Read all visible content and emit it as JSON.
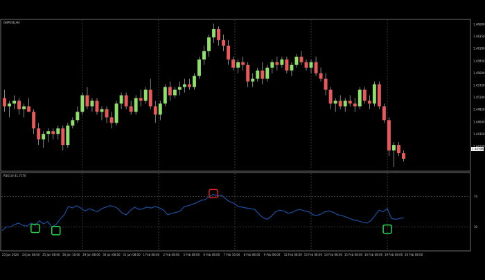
{
  "window": {
    "price_pane_title": "GBPUSD,H4",
    "indicator_pane_title": "RSI(14) 41.7170"
  },
  "price_axis": {
    "labels": [
      "1.46600",
      "1.46350",
      "1.46100",
      "1.45850",
      "1.45600",
      "1.45350",
      "1.45100",
      "1.44850",
      "1.44600",
      "1.44350",
      "1.44100"
    ],
    "current_price": "1.44398"
  },
  "rsi_axis": {
    "labels": [
      "70",
      "30"
    ]
  },
  "time_axis": {
    "labels": [
      "23 Jan 2024",
      "24 Jan 08:00",
      "25 Jan 08:00",
      "26 Jan 16:00",
      "29 Jan 08:00",
      "30 Jan 08:00",
      "31 Jan 08:00",
      "1 Feb 08:00",
      "2 Feb 08:00",
      "5 Feb 08:00",
      "6 Feb 08:00",
      "7 Feb 16:00",
      "8 Feb 08:00",
      "9 Feb 08:00",
      "12 Feb 08:00",
      "13 Feb 08:00",
      "14 Feb 08:00",
      "15 Feb 08:00",
      "16 Feb 08:00",
      "19 Feb 08:00",
      "20 Feb 08:00"
    ]
  },
  "colors": {
    "background": "#000000",
    "bull_candle": "#8ee06a",
    "bear_candle": "#e85a5a",
    "wick": "#bdbdbd",
    "grid": "#5a5a5a",
    "rsi_line": "#1d4f9e",
    "overbought_marker": "#e02020",
    "oversold_marker": "#2bd44a",
    "axis_text": "#c8c8c8",
    "current_price_box": "#ffffff"
  },
  "chart_data": [
    {
      "type": "candlestick",
      "title": "GBPUSD,H4",
      "ylim": [
        1.4395,
        1.4665
      ],
      "candles": [
        [
          1.4525,
          1.454,
          1.45,
          1.451
        ],
        [
          1.451,
          1.452,
          1.449,
          1.4515
        ],
        [
          1.4515,
          1.453,
          1.4505,
          1.452
        ],
        [
          1.452,
          1.4525,
          1.4495,
          1.4505
        ],
        [
          1.4505,
          1.4515,
          1.449,
          1.451
        ],
        [
          1.451,
          1.4525,
          1.45,
          1.45
        ],
        [
          1.45,
          1.4505,
          1.446,
          1.447
        ],
        [
          1.447,
          1.448,
          1.444,
          1.445
        ],
        [
          1.445,
          1.4465,
          1.4435,
          1.446
        ],
        [
          1.446,
          1.447,
          1.4445,
          1.4465
        ],
        [
          1.4465,
          1.447,
          1.445,
          1.446
        ],
        [
          1.446,
          1.4475,
          1.445,
          1.447
        ],
        [
          1.447,
          1.4475,
          1.443,
          1.444
        ],
        [
          1.444,
          1.448,
          1.4435,
          1.4475
        ],
        [
          1.4475,
          1.449,
          1.447,
          1.4485
        ],
        [
          1.4485,
          1.451,
          1.448,
          1.45
        ],
        [
          1.45,
          1.4535,
          1.4495,
          1.453
        ],
        [
          1.453,
          1.4545,
          1.4505,
          1.451
        ],
        [
          1.451,
          1.4525,
          1.45,
          1.452
        ],
        [
          1.452,
          1.4525,
          1.4495,
          1.45
        ],
        [
          1.45,
          1.451,
          1.4485,
          1.4505
        ],
        [
          1.4505,
          1.451,
          1.448,
          1.449
        ],
        [
          1.449,
          1.45,
          1.447,
          1.448
        ],
        [
          1.448,
          1.452,
          1.4475,
          1.4515
        ],
        [
          1.4515,
          1.4535,
          1.4505,
          1.453
        ],
        [
          1.453,
          1.4535,
          1.4505,
          1.451
        ],
        [
          1.451,
          1.452,
          1.4495,
          1.45
        ],
        [
          1.45,
          1.453,
          1.4495,
          1.4525
        ],
        [
          1.4525,
          1.454,
          1.451,
          1.452
        ],
        [
          1.452,
          1.4545,
          1.4515,
          1.454
        ],
        [
          1.454,
          1.456,
          1.4505,
          1.451
        ],
        [
          1.451,
          1.452,
          1.448,
          1.4495
        ],
        [
          1.4495,
          1.452,
          1.4485,
          1.4515
        ],
        [
          1.4515,
          1.455,
          1.451,
          1.4545
        ],
        [
          1.4545,
          1.4555,
          1.452,
          1.453
        ],
        [
          1.453,
          1.4545,
          1.4525,
          1.454
        ],
        [
          1.454,
          1.4555,
          1.453,
          1.4545
        ],
        [
          1.4545,
          1.456,
          1.4535,
          1.455
        ],
        [
          1.455,
          1.456,
          1.454,
          1.4545
        ],
        [
          1.4545,
          1.457,
          1.454,
          1.4565
        ],
        [
          1.4565,
          1.46,
          1.456,
          1.4595
        ],
        [
          1.4595,
          1.462,
          1.4585,
          1.461
        ],
        [
          1.461,
          1.464,
          1.46,
          1.4635
        ],
        [
          1.4635,
          1.466,
          1.4625,
          1.465
        ],
        [
          1.465,
          1.4655,
          1.462,
          1.463
        ],
        [
          1.463,
          1.464,
          1.461,
          1.462
        ],
        [
          1.462,
          1.463,
          1.4585,
          1.4595
        ],
        [
          1.4595,
          1.46,
          1.4575,
          1.458
        ],
        [
          1.458,
          1.4595,
          1.457,
          1.459
        ],
        [
          1.459,
          1.46,
          1.4575,
          1.4585
        ],
        [
          1.4585,
          1.459,
          1.4545,
          1.4555
        ],
        [
          1.4555,
          1.457,
          1.4545,
          1.456
        ],
        [
          1.456,
          1.458,
          1.4555,
          1.4575
        ],
        [
          1.4575,
          1.459,
          1.455,
          1.456
        ],
        [
          1.456,
          1.4585,
          1.4555,
          1.458
        ],
        [
          1.458,
          1.4595,
          1.457,
          1.459
        ],
        [
          1.459,
          1.46,
          1.4575,
          1.4585
        ],
        [
          1.4585,
          1.46,
          1.458,
          1.4595
        ],
        [
          1.4595,
          1.46,
          1.457,
          1.4575
        ],
        [
          1.4575,
          1.459,
          1.4565,
          1.4585
        ],
        [
          1.4585,
          1.4605,
          1.458,
          1.46
        ],
        [
          1.46,
          1.461,
          1.4585,
          1.459
        ],
        [
          1.459,
          1.4595,
          1.4575,
          1.458
        ],
        [
          1.458,
          1.4595,
          1.457,
          1.459
        ],
        [
          1.459,
          1.46,
          1.4565,
          1.457
        ],
        [
          1.457,
          1.458,
          1.4555,
          1.456
        ],
        [
          1.456,
          1.457,
          1.453,
          1.454
        ],
        [
          1.454,
          1.4545,
          1.4505,
          1.4515
        ],
        [
          1.4515,
          1.4525,
          1.45,
          1.452
        ],
        [
          1.452,
          1.453,
          1.4505,
          1.451
        ],
        [
          1.451,
          1.4525,
          1.45,
          1.452
        ],
        [
          1.452,
          1.453,
          1.451,
          1.4515
        ],
        [
          1.4515,
          1.4525,
          1.45,
          1.451
        ],
        [
          1.451,
          1.4545,
          1.4505,
          1.454
        ],
        [
          1.454,
          1.4545,
          1.4515,
          1.452
        ],
        [
          1.452,
          1.453,
          1.4505,
          1.4515
        ],
        [
          1.4515,
          1.4555,
          1.451,
          1.455
        ],
        [
          1.455,
          1.4555,
          1.4505,
          1.451
        ],
        [
          1.451,
          1.4515,
          1.448,
          1.4485
        ],
        [
          1.4485,
          1.449,
          1.442,
          1.443
        ],
        [
          1.443,
          1.4445,
          1.44,
          1.444
        ],
        [
          1.444,
          1.4445,
          1.442,
          1.4425
        ],
        [
          1.4425,
          1.443,
          1.441,
          1.4415
        ]
      ]
    },
    {
      "type": "line",
      "title": "RSI(14) 41.7170",
      "ylim": [
        0,
        100
      ],
      "levels": [
        70,
        30
      ],
      "values": [
        25,
        30,
        30,
        33,
        35,
        32,
        31,
        35,
        32,
        38,
        34,
        37,
        30,
        33,
        40,
        46,
        57,
        55,
        58,
        55,
        51,
        54,
        52,
        50,
        54,
        56,
        58,
        57,
        54,
        48,
        46,
        52,
        56,
        53,
        54,
        56,
        55,
        57,
        55,
        52,
        46,
        48,
        49,
        51,
        57,
        58,
        60,
        62,
        65,
        66,
        70,
        73,
        71,
        72,
        67,
        63,
        61,
        57,
        56,
        55,
        54,
        53,
        47,
        42,
        40,
        44,
        50,
        52,
        51,
        48,
        49,
        52,
        53,
        51,
        50,
        46,
        45,
        47,
        50,
        51,
        49,
        46,
        45,
        43,
        41,
        39,
        38,
        36,
        35,
        38,
        45,
        52,
        50,
        54,
        41,
        40,
        41,
        42
      ],
      "markers": [
        {
          "index": 8,
          "value": 28,
          "kind": "oversold"
        },
        {
          "index": 13,
          "value": 25,
          "kind": "oversold"
        },
        {
          "index": 51,
          "value": 74,
          "kind": "overbought"
        },
        {
          "index": 93,
          "value": 27,
          "kind": "oversold"
        }
      ]
    }
  ]
}
